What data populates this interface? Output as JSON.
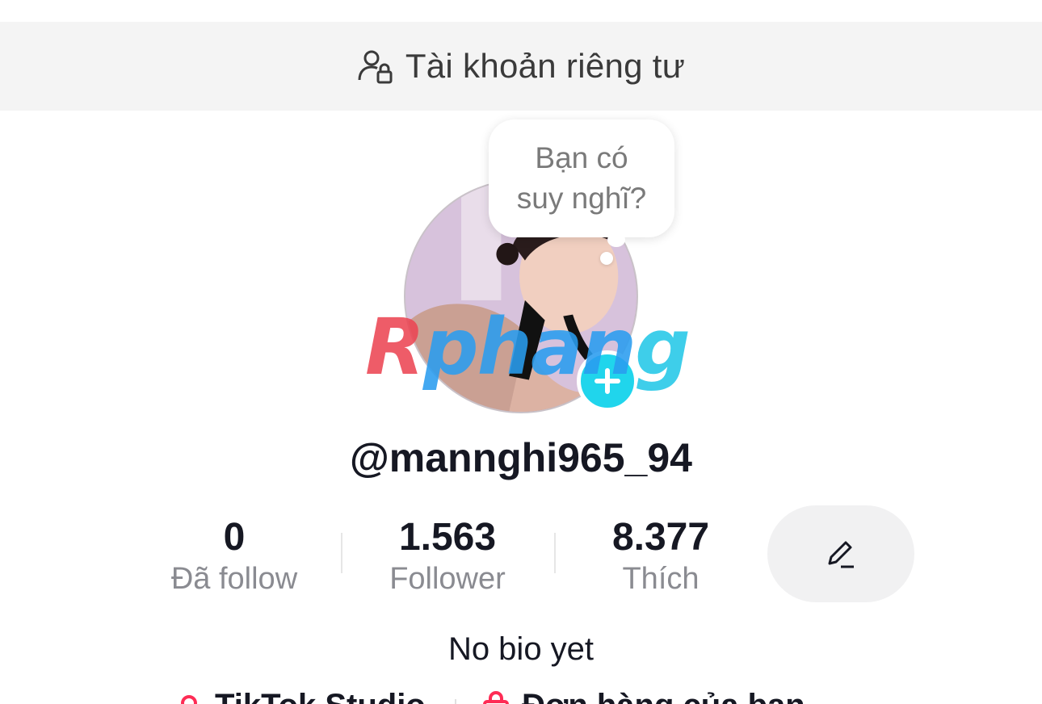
{
  "banner": {
    "label": "Tài khoản riêng tư",
    "icon": "person-lock-icon"
  },
  "thought_bubble": {
    "line1": "Bạn có",
    "line2": "suy nghĩ?"
  },
  "avatar": {
    "badge_icon": "plus-icon",
    "badge_color": "#20d5ec"
  },
  "watermark": {
    "part1": "R",
    "part2": "phan",
    "part3": "g"
  },
  "profile": {
    "username": "@mannghi965_94",
    "bio": "No bio yet"
  },
  "stats": [
    {
      "value": "0",
      "label": "Đã follow"
    },
    {
      "value": "1.563",
      "label": "Follower"
    },
    {
      "value": "8.377",
      "label": "Thích"
    }
  ],
  "edit_button": {
    "icon": "pencil-icon"
  },
  "links": [
    {
      "label": "TikTok Studio",
      "icon": "studio-icon"
    },
    {
      "label": "Đơn hàng của bạn",
      "icon": "shopping-bag-icon"
    }
  ],
  "colors": {
    "accent": "#20d5ec",
    "text": "#161823",
    "muted": "#8a8b91",
    "link_icon": "#fe2c55"
  }
}
